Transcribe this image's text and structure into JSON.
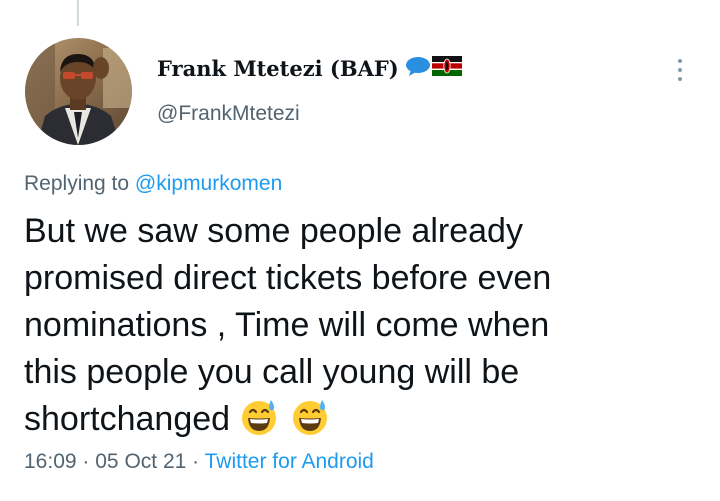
{
  "tweet": {
    "author": {
      "display_name": "Frank Mtetezi (BAF)",
      "handle": "@FrankMtetezi",
      "badges": [
        "speech-bubble-icon",
        "kenya-flag-icon"
      ]
    },
    "replying_to": {
      "prefix": "Replying to",
      "mention": "@kipmurkomen"
    },
    "text_line1": "But we saw some people already",
    "text_line2": "promised direct tickets before even",
    "text_line3": "nominations , Time will come when",
    "text_line4": "this people you call young will be",
    "text_line5": "shortchanged",
    "emojis": [
      "grinning-sweat-emoji",
      "grinning-sweat-emoji"
    ],
    "time": "16:09",
    "separator": "·",
    "date": "05 Oct 21",
    "source": "Twitter for Android"
  },
  "colors": {
    "text": "#0f1419",
    "secondary": "#536471",
    "link": "#1d9bf0",
    "thread_line": "#cfd9de"
  }
}
